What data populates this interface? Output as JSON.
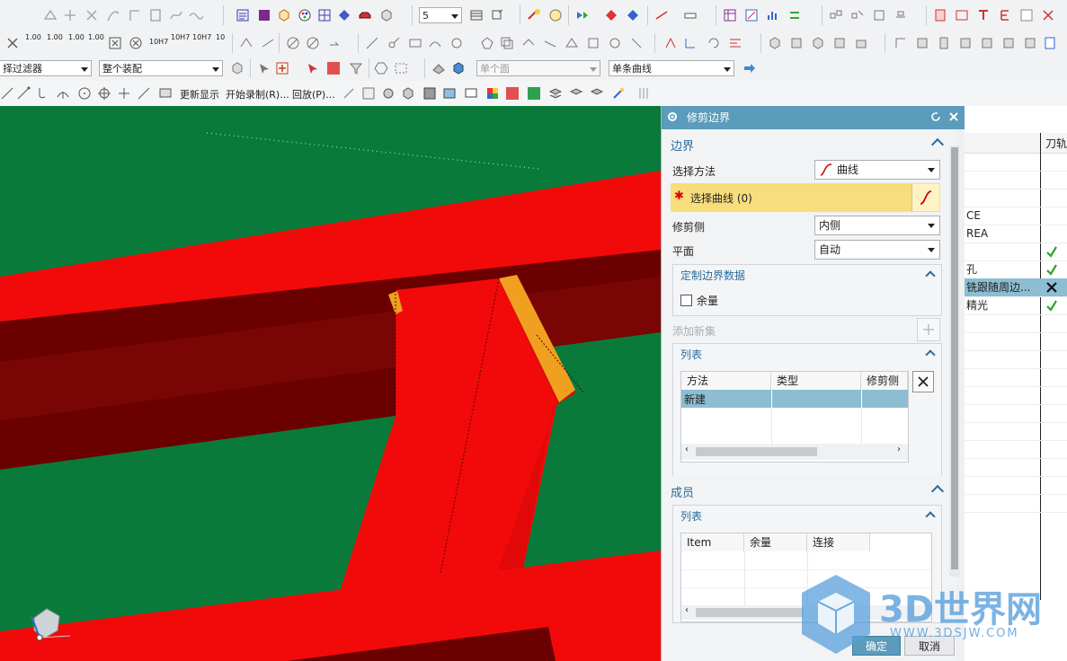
{
  "toolbar": {
    "filter_label": "择过滤器",
    "assembly_label": "整个装配",
    "layer_value": "5",
    "face_rule": "单个面",
    "curve_rule": "单条曲线",
    "update_display": "更新显示",
    "start_record": "开始录制(R)...",
    "playback": "回放(P)...",
    "precision_labels": [
      "1.00",
      "1.00",
      "1.00",
      "1.00",
      "10H7",
      "10H7",
      "10H7",
      "10"
    ]
  },
  "dialog": {
    "title": "修剪边界",
    "boundary_section": "边界",
    "select_method_label": "选择方法",
    "select_method_value": "曲线",
    "select_curve_label": "选择曲线 (0)",
    "trim_side_label": "修剪侧",
    "trim_side_value": "内侧",
    "plane_label": "平面",
    "plane_value": "自动",
    "custom_boundary_section": "定制边界数据",
    "allowance_checkbox": "余量",
    "add_new_set": "添加新集",
    "list_section": "列表",
    "list_columns": [
      "方法",
      "类型",
      "修剪侧"
    ],
    "list_rows": [
      [
        "新建",
        "",
        ""
      ]
    ],
    "members_section": "成员",
    "members_list_section": "列表",
    "members_columns": [
      "Item",
      "余量",
      "连接"
    ],
    "ok_button": "确定",
    "cancel_button": "取消"
  },
  "navigator": {
    "column_header": "刀轨",
    "rows": [
      {
        "text": "",
        "status": ""
      },
      {
        "text": "",
        "status": ""
      },
      {
        "text": "",
        "status": ""
      },
      {
        "text": "CE",
        "status": ""
      },
      {
        "text": "REA",
        "status": ""
      },
      {
        "text": "",
        "status": "check"
      },
      {
        "text": "孔",
        "status": "check"
      },
      {
        "text": "铣跟随周边...",
        "status": "cross",
        "selected": true
      },
      {
        "text": "精光",
        "status": "check"
      }
    ]
  },
  "watermark": {
    "brand": "3D世界网",
    "url": "WWW.3DSJW.COM"
  },
  "colors": {
    "accent": "#5b9bbb",
    "highlight_row": "#e8d47a",
    "model_red": "#f20a0a",
    "model_green": "#0a7a3a",
    "model_dark": "#6a0000",
    "model_orange": "#f0a020"
  }
}
